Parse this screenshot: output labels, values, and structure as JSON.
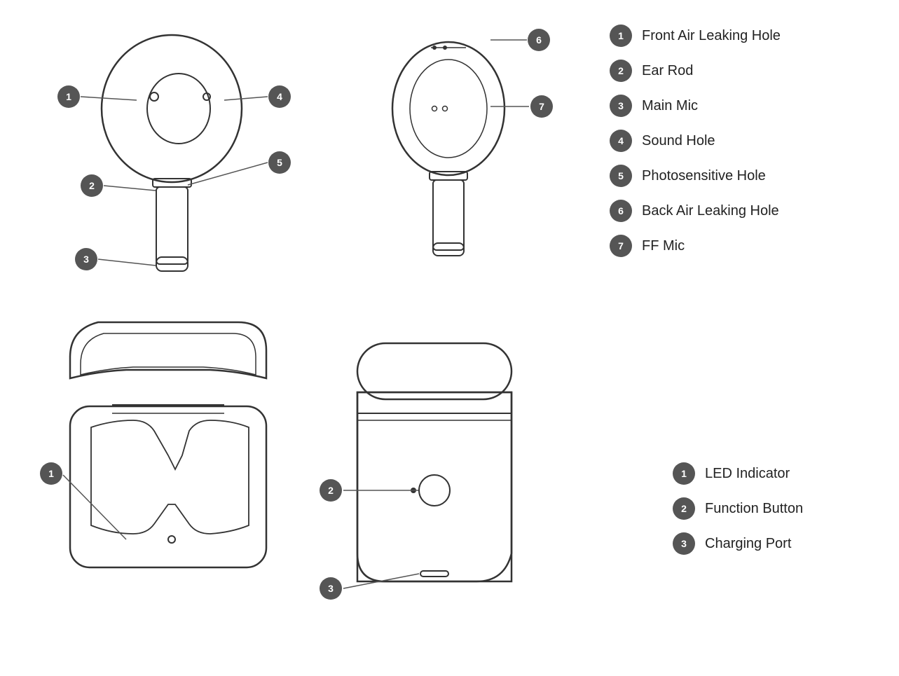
{
  "top_legend": {
    "items": [
      {
        "number": "1",
        "label": "Front Air Leaking Hole"
      },
      {
        "number": "2",
        "label": "Ear Rod"
      },
      {
        "number": "3",
        "label": "Main Mic"
      },
      {
        "number": "4",
        "label": "Sound Hole"
      },
      {
        "number": "5",
        "label": "Photosensitive Hole"
      },
      {
        "number": "6",
        "label": "Back Air Leaking Hole"
      },
      {
        "number": "7",
        "label": "FF Mic"
      }
    ]
  },
  "bottom_legend": {
    "items": [
      {
        "number": "1",
        "label": "LED Indicator"
      },
      {
        "number": "2",
        "label": "Function Button"
      },
      {
        "number": "3",
        "label": "Charging Port"
      }
    ]
  }
}
